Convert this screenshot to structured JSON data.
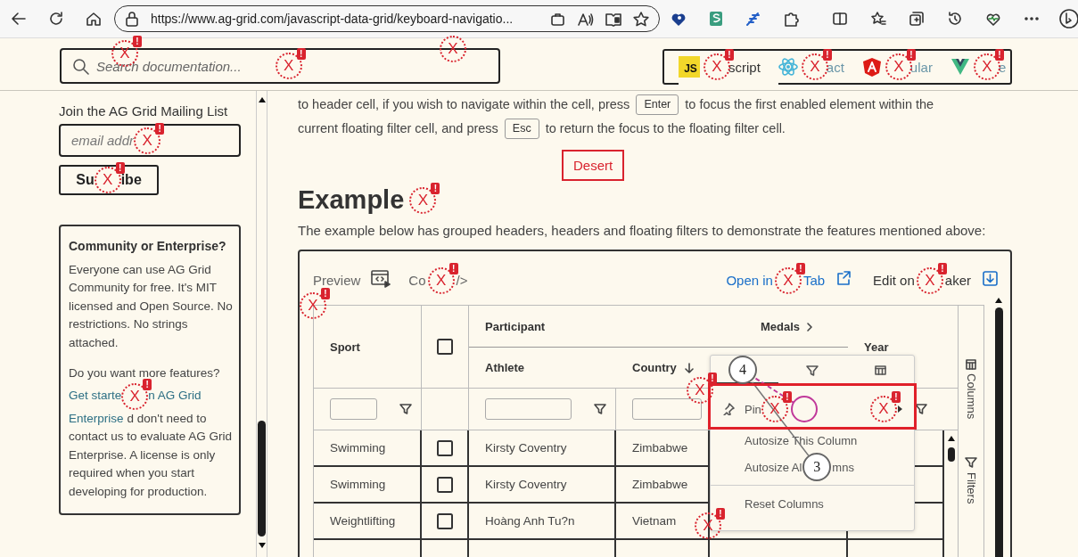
{
  "browser": {
    "url": "https://www.ag-grid.com/javascript-data-grid/keyboard-navigatio..."
  },
  "header": {
    "search": {
      "placeholder": "Search documentation...",
      "marker": {
        "label": "X",
        "badge": "!"
      }
    },
    "markers": [
      {
        "label": "X",
        "badge": "!"
      },
      {
        "label": "X"
      }
    ],
    "frameworks": [
      {
        "kind": "tile",
        "logo": "JS",
        "label": "script",
        "selected": true,
        "marker": {
          "label": "X",
          "badge": "!"
        }
      },
      {
        "kind": "atom",
        "label": "act",
        "selected": false,
        "marker": {
          "label": "X",
          "badge": "!"
        }
      },
      {
        "kind": "shield",
        "label": "ular",
        "selected": false,
        "marker": {
          "label": "X",
          "badge": "!"
        }
      },
      {
        "kind": "chevron",
        "label": "e",
        "selected": false,
        "marker": {
          "label": "X",
          "badge": "!"
        }
      }
    ]
  },
  "sidebar": {
    "mailing_title": "Join the AG Grid Mailing List",
    "email": {
      "placeholder": "email addr",
      "marker": {
        "label": "X",
        "badge": "!"
      }
    },
    "subscribe": {
      "before": "Su",
      "after": "ibe",
      "marker": {
        "label": "X",
        "badge": "!"
      }
    },
    "card": {
      "title": "Community or Enterprise?",
      "text": "Everyone can use AG Grid Community for free. It's MIT licensed and Open Source. No restrictions. No strings attached.",
      "lines": [
        [
          {
            "kind": "text",
            "text": "Do you want more features?"
          }
        ],
        [
          {
            "kind": "link",
            "text": "Get starte"
          },
          {
            "kind": "marker",
            "label": "X",
            "badge": "!"
          },
          {
            "kind": "link",
            "text": "n AG Grid"
          }
        ],
        [
          {
            "kind": "link",
            "text": "Enterprise"
          },
          {
            "kind": "text",
            "text": "d don't need to"
          }
        ],
        [
          {
            "kind": "text",
            "text": "contact us to evaluate AG Grid Enterprise. A license is only required when you start developing for production."
          }
        ]
      ]
    }
  },
  "content": {
    "paragraph": [
      [
        {
          "kind": "text",
          "text": "to header cell, if you wish to navigate within the cell, press"
        },
        {
          "kind": "key",
          "text": "Enter"
        },
        {
          "kind": "text",
          "text": "to focus the first enabled element within the"
        }
      ],
      [
        {
          "kind": "text",
          "text": "current floating filter cell, and press"
        },
        {
          "kind": "key",
          "text": "Esc"
        },
        {
          "kind": "text",
          "text": "to return the focus to the floating filter cell."
        }
      ]
    ],
    "annotation_label": "Desert",
    "heading": "Example",
    "heading_marker": {
      "label": "X",
      "badge": "!"
    },
    "intro": "The example below has grouped headers, headers and floating filters to demonstrate the features mentioned above:",
    "example": {
      "preview": {
        "label": "Preview"
      },
      "code": {
        "before": "Co",
        "after": "/>",
        "marker": {
          "label": "X",
          "badge": "!"
        }
      },
      "open": {
        "before": "Open in",
        "after": "Tab",
        "marker": {
          "label": "X",
          "badge": "!"
        }
      },
      "edit": {
        "before": "Edit on",
        "after": "aker",
        "marker": {
          "label": "X",
          "badge": "!"
        }
      },
      "grid": {
        "corner_marker": {
          "label": "X",
          "badge": "!"
        },
        "groups": [
          {
            "label": "Participant"
          },
          {
            "label": "Medals"
          }
        ],
        "columns": [
          {
            "label": "Sport"
          },
          {
            "checked": false
          },
          {
            "label": "Athlete"
          },
          {
            "label": "Country"
          },
          {
            "label": "Year"
          }
        ],
        "rows": [
          {
            "sport": "Swimming",
            "checked": false,
            "athlete": "Kirsty Coventry",
            "country": "Zimbabwe"
          },
          {
            "sport": "Swimming",
            "checked": false,
            "athlete": "Kirsty Coventry",
            "country": "Zimbabwe"
          },
          {
            "sport": "Weightlifting",
            "checked": false,
            "athlete": "Hoàng Anh Tu?n",
            "country": "Vietnam"
          }
        ],
        "side_tabs": [
          {
            "kind": "columns",
            "label": "Columns"
          },
          {
            "kind": "filters",
            "label": "Filters"
          }
        ],
        "markers": [
          {
            "label": "X",
            "badge": "!"
          }
        ],
        "menu": {
          "tabs": [
            {
              "selected": true
            },
            {
              "selected": false
            },
            {
              "selected": false
            }
          ],
          "items": [
            {
              "kind": "pin",
              "label": "Pin",
              "marker": {
                "label": "X",
                "badge": "!"
              },
              "end_marker": {
                "label": "X",
                "badge": "!"
              }
            },
            {
              "kind": "plain",
              "label": "Autosize This Column"
            },
            {
              "kind": "split",
              "before": "Autosize Al",
              "after": "mns"
            },
            {
              "kind": "divider"
            },
            {
              "kind": "plain",
              "label": "Reset Columns"
            }
          ],
          "callouts": [
            {
              "number": "4"
            },
            {
              "number": "3"
            }
          ],
          "markers": [
            {
              "label": "X",
              "badge": "!"
            }
          ]
        }
      }
    }
  }
}
